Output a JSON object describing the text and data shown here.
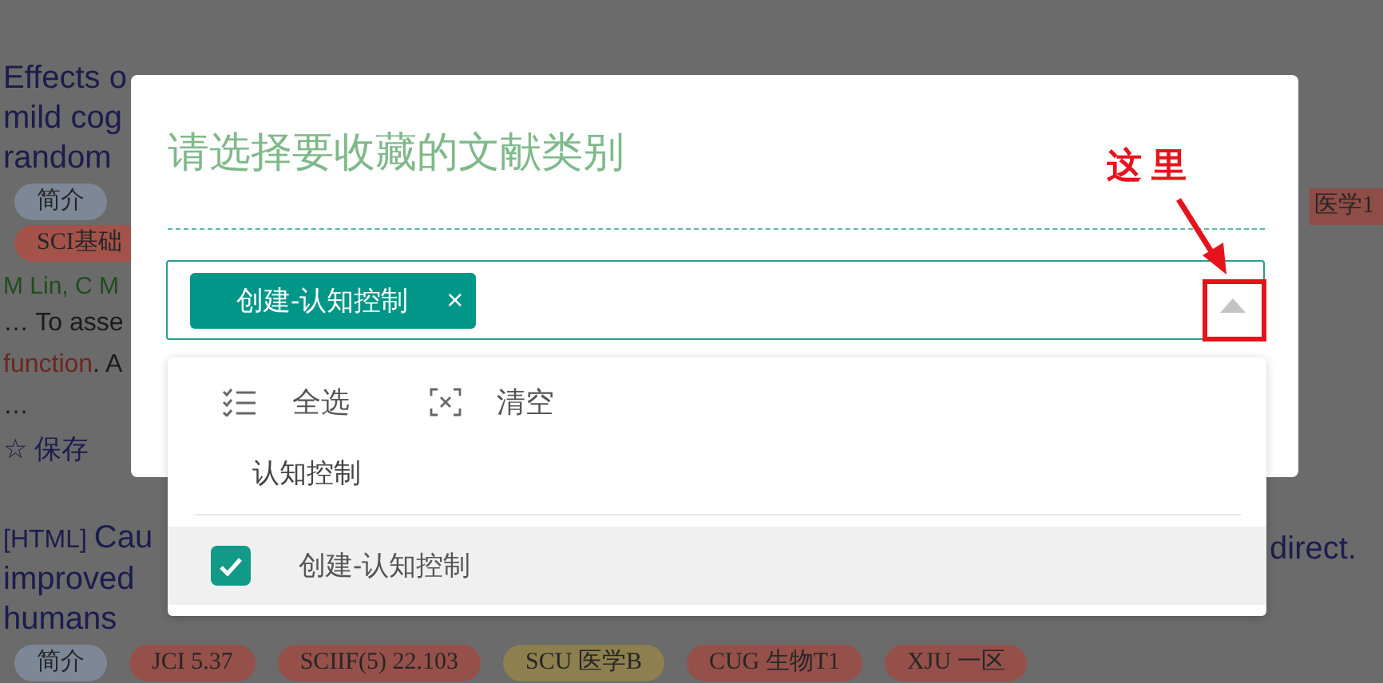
{
  "results": [
    {
      "title_lines": [
        [
          {
            "text": "Effects o",
            "kind": "plain"
          }
        ],
        [
          {
            "text": "mild cog",
            "kind": "plain"
          }
        ],
        [
          {
            "text": "random",
            "kind": "plain"
          }
        ]
      ],
      "tag_rows": [
        [
          {
            "label": "简介",
            "color": "#7d8795"
          }
        ],
        [
          {
            "label": "SCI基础",
            "color": "#a3534a"
          }
        ]
      ],
      "side_texts": [
        {
          "text": "医学1",
          "kind": "tag",
          "color": "#8f4d47"
        }
      ],
      "authors": "M Lin, C M",
      "snippet_lines": [
        [
          {
            "text": "… To asse",
            "kind": "plain"
          }
        ],
        [
          {
            "text": "function",
            "kind": "highlight"
          },
          {
            "text": ". A",
            "kind": "plain"
          }
        ],
        [
          {
            "text": "…",
            "kind": "plain"
          }
        ]
      ],
      "save": {
        "icon": "☆",
        "label": "保存"
      }
    },
    {
      "title_lines": [
        [
          {
            "text": "[HTML] ",
            "kind": "format"
          },
          {
            "text": "Cau",
            "kind": "plain"
          }
        ],
        [
          {
            "text": "improved",
            "kind": "plain"
          }
        ],
        [
          {
            "text": "humans",
            "kind": "plain"
          }
        ]
      ],
      "tag_rows": [
        [
          {
            "label": "简介",
            "color": "#7d8795"
          },
          {
            "label": "JCI 5.37",
            "color": "#96504a"
          },
          {
            "label": "SCIIF(5) 22.103",
            "color": "#96504a"
          },
          {
            "label": "SCU 医学B",
            "color": "#8d7f4e"
          },
          {
            "label": "CUG 生物T1",
            "color": "#96504a"
          },
          {
            "label": "XJU 一区",
            "color": "#96504a"
          }
        ]
      ],
      "side_texts": [
        {
          "text": "direct.",
          "kind": "link"
        }
      ]
    }
  ],
  "dialog": {
    "title": "请选择要收藏的文献类别",
    "select": {
      "expanded": true,
      "chips": [
        {
          "label": "创建-认知控制",
          "remove": "×"
        }
      ]
    },
    "dropdown": {
      "actions": [
        {
          "label": "全选",
          "kind": "select-all"
        },
        {
          "label": "清空",
          "kind": "clear"
        }
      ],
      "groups": [
        {
          "label": "认知控制",
          "options": [
            {
              "label": "创建-认知控制",
              "checked": true,
              "highlighted": true
            }
          ]
        }
      ]
    }
  },
  "annotation": {
    "text": "这里"
  }
}
